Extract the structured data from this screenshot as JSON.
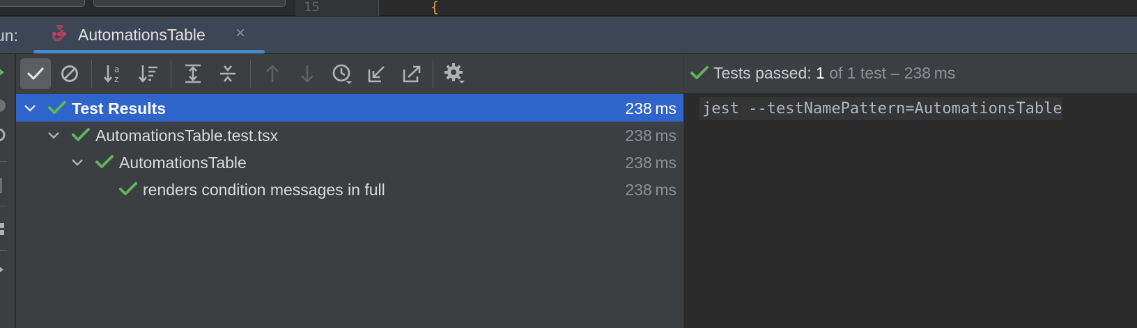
{
  "editor": {
    "line_number": "15",
    "code_fragment": "{"
  },
  "run_panel": {
    "label": "un:",
    "tab": {
      "title": "AutomationsTable",
      "close_glyph": "×",
      "icon": "jest-icon"
    }
  },
  "toolbar": {
    "buttons": [
      {
        "name": "show-passed-toggle",
        "icon": "check-icon",
        "pressed": true
      },
      {
        "name": "show-ignored-toggle",
        "icon": "cancel-circle-icon"
      },
      {
        "name": "sort-alphabetically-button",
        "icon": "sort-alpha-icon"
      },
      {
        "name": "sort-by-duration-button",
        "icon": "sort-duration-icon"
      },
      {
        "name": "expand-all-button",
        "icon": "expand-all-icon"
      },
      {
        "name": "collapse-all-button",
        "icon": "collapse-all-icon"
      },
      {
        "name": "previous-failed-button",
        "icon": "arrow-up-icon",
        "enabled": false
      },
      {
        "name": "next-failed-button",
        "icon": "arrow-down-icon",
        "enabled": false
      },
      {
        "name": "test-history-button",
        "icon": "history-clock-icon"
      },
      {
        "name": "import-tests-button",
        "icon": "import-icon"
      },
      {
        "name": "export-tests-button",
        "icon": "export-icon"
      },
      {
        "name": "settings-button",
        "icon": "gear-icon"
      }
    ]
  },
  "tree": {
    "rows": [
      {
        "label": "Test Results",
        "duration": "238 ms",
        "status": "passed",
        "selected": true,
        "expanded": true
      },
      {
        "label": "AutomationsTable.test.tsx",
        "duration": "238 ms",
        "status": "passed",
        "expanded": true
      },
      {
        "label": "AutomationsTable",
        "duration": "238 ms",
        "status": "passed",
        "expanded": true
      },
      {
        "label": "renders condition messages in full",
        "duration": "238 ms",
        "status": "passed"
      }
    ]
  },
  "console": {
    "status": {
      "label": "Tests passed: ",
      "passed_count": "1",
      "rest": " of 1 test – 238 ms"
    },
    "command": "jest --testNamePattern=AutomationsTable"
  },
  "colors": {
    "accent": "#4a88c7",
    "selection": "#2f65ca",
    "pass_green": "#5fb358",
    "header_bg": "#3d4654",
    "panel_bg": "#3c3f41",
    "console_bg": "#2b2b2b"
  }
}
